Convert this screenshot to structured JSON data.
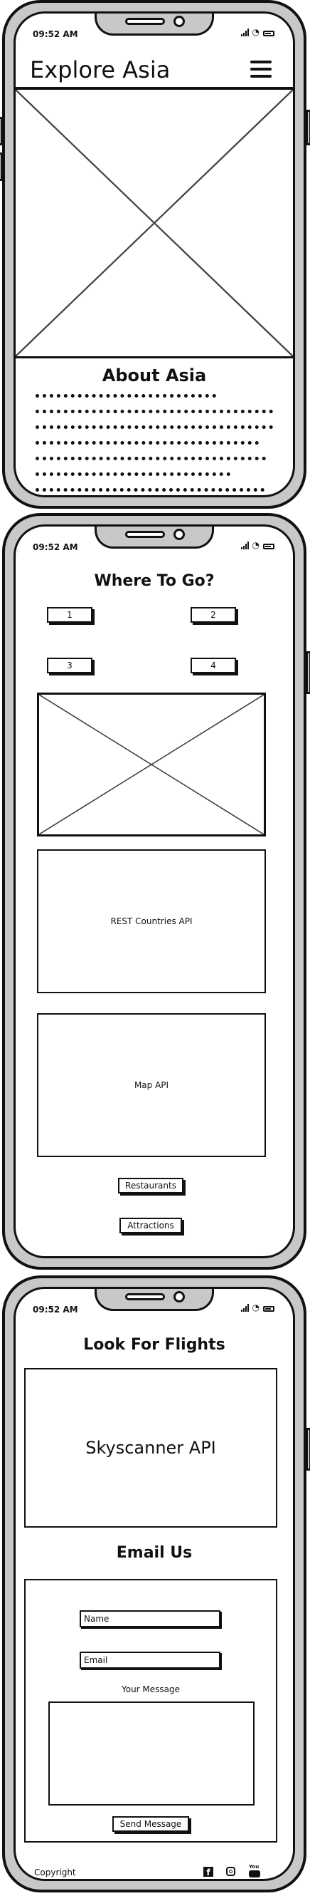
{
  "status": {
    "time": "09:52 AM"
  },
  "screen1": {
    "app_title": "Explore Asia",
    "menu_icon": "hamburger-menu-icon",
    "about_heading": "About Asia"
  },
  "screen2": {
    "heading": "Where To Go?",
    "buttons": [
      "1",
      "2",
      "3",
      "4"
    ],
    "countries_box": "REST Countries API",
    "map_box": "Map API",
    "restaurants_button": "Restaurants",
    "attractions_button": "Attractions"
  },
  "screen3": {
    "flights_heading": "Look For Flights",
    "flights_box": "Skyscanner API",
    "email_heading": "Email Us",
    "name_placeholder": "Name",
    "email_placeholder": "Email",
    "message_label": "Your Message",
    "send_button": "Send Message",
    "copyright": "Copyright",
    "social_icons": [
      "facebook-icon",
      "instagram-icon",
      "youtube-icon"
    ]
  },
  "colors": {
    "outline": "#111111",
    "phone_body": "#c8c8c8",
    "screen": "#ffffff"
  }
}
